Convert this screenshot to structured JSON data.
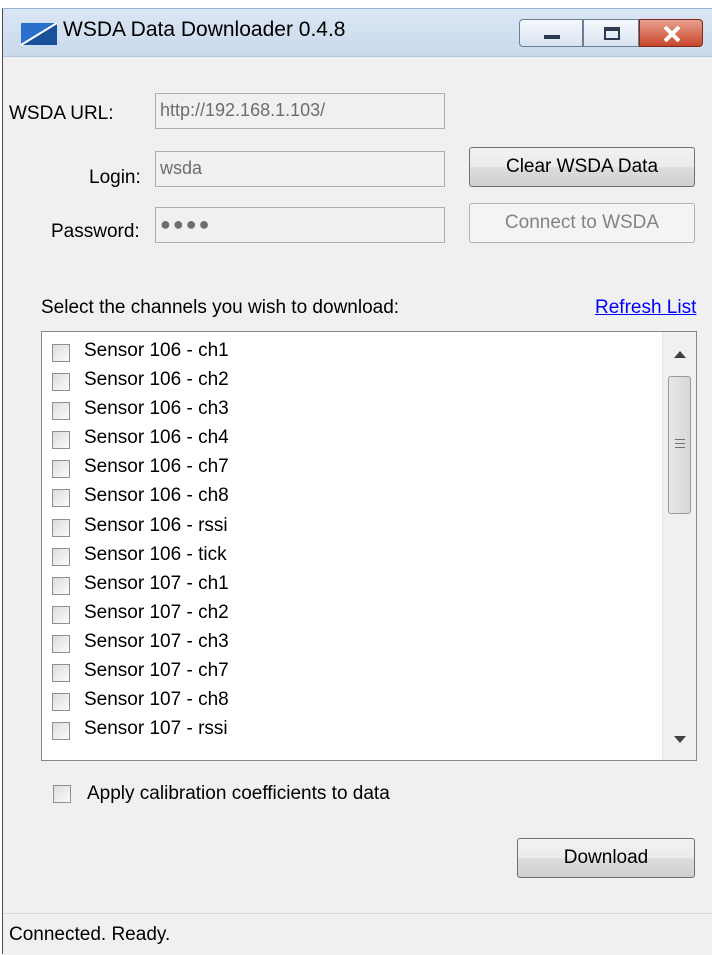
{
  "window": {
    "title": "WSDA Data Downloader 0.4.8"
  },
  "form": {
    "url_label": "WSDA URL:",
    "url_value": "http://192.168.1.103/",
    "login_label": "Login:",
    "login_value": "wsda",
    "password_label": "Password:",
    "password_value": "●●●●"
  },
  "buttons": {
    "clear": "Clear WSDA Data",
    "connect": "Connect to WSDA",
    "download": "Download"
  },
  "channels": {
    "prompt": "Select the channels you wish to download:",
    "refresh_label": "Refresh List",
    "items": [
      "Sensor 106 - ch1",
      "Sensor 106 - ch2",
      "Sensor 106 - ch3",
      "Sensor 106 - ch4",
      "Sensor 106 - ch7",
      "Sensor 106 - ch8",
      "Sensor 106 - rssi",
      "Sensor 106 - tick",
      "Sensor 107 - ch1",
      "Sensor 107 - ch2",
      "Sensor 107 - ch3",
      "Sensor 107 - ch7",
      "Sensor 107 - ch8",
      "Sensor 107 - rssi"
    ]
  },
  "options": {
    "calibration_label": "Apply calibration coefficients to data"
  },
  "status": {
    "text": "Connected. Ready."
  },
  "colors": {
    "link": "#0000ff",
    "close_button": "#c8462a"
  }
}
